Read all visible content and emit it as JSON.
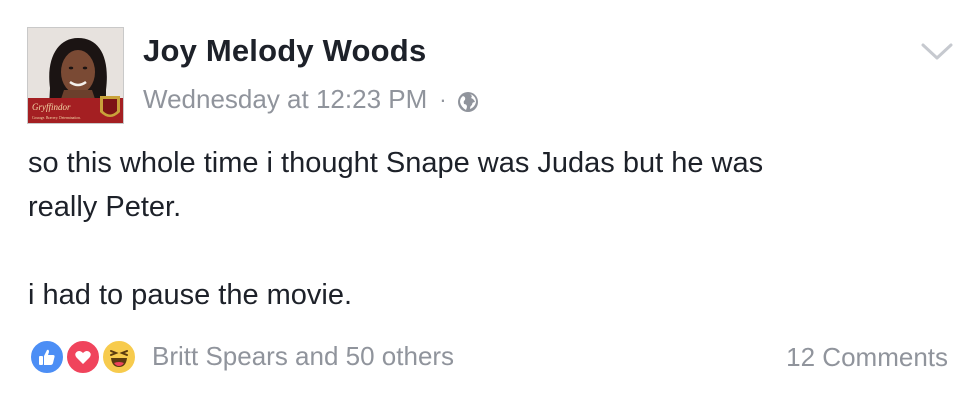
{
  "post": {
    "author": "Joy Melody Woods",
    "timestamp": "Wednesday at 12:23 PM",
    "separator": "·",
    "privacy_icon": "globe-icon",
    "menu_icon": "chevron-down-icon",
    "avatar": {
      "banner_text": "Gryffindor",
      "banner_subtext": "Courage. Bravery. Determination.",
      "banner_color": "#a41f22"
    },
    "body_lines": [
      "so this whole time i thought Snape was Judas but he was",
      "really Peter.",
      "i had to pause the movie."
    ],
    "reactions": {
      "icons": [
        "like-icon",
        "love-icon",
        "haha-icon"
      ],
      "summary": "Britt Spears and 50 others"
    },
    "comments": "12 Comments"
  },
  "colors": {
    "text": "#1d2129",
    "muted": "#90949c",
    "like": "#4c8ef5",
    "love": "#f0445c",
    "haha": "#f7cb4d"
  }
}
